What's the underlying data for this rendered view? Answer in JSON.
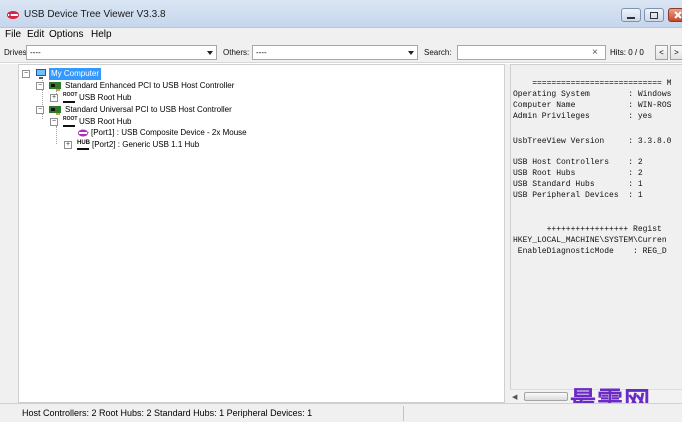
{
  "window": {
    "title": "USB Device Tree Viewer V3.3.8",
    "icon": "usb-icon",
    "controls": [
      "minimize-icon",
      "maximize-icon",
      "close-icon"
    ]
  },
  "menu": [
    "File",
    "Edit",
    "Options",
    "Help"
  ],
  "toolbar": {
    "drives_label": "Drives:",
    "drives_value": "----",
    "others_label": "Others:",
    "others_value": "----",
    "search_label": "Search:",
    "search_value": "",
    "clear_glyph": "×",
    "hits": "Hits: 0 / 0",
    "prev_label": "<",
    "next_label": ">"
  },
  "tree": [
    {
      "label": "My Computer",
      "icon": "computer-icon",
      "selected": true,
      "expander": "−"
    },
    {
      "label": "Standard Enhanced PCI to USB Host Controller",
      "icon": "pci-card-icon",
      "expander": "−"
    },
    {
      "label": "USB Root Hub",
      "icon": "root-hub-icon",
      "icon_text": "ROOT",
      "expander": "+"
    },
    {
      "label": "Standard Universal PCI to USB Host Controller",
      "icon": "pci-card-icon",
      "expander": "−"
    },
    {
      "label": "USB Root Hub",
      "icon": "root-hub-icon",
      "icon_text": "ROOT",
      "expander": "−"
    },
    {
      "label": "[Port1] : USB Composite Device - 2x Mouse",
      "icon": "usb-device-icon"
    },
    {
      "label": "[Port2] : Generic USB 1.1 Hub",
      "icon": "hub-icon",
      "icon_text": "HUB",
      "expander": "+"
    }
  ],
  "info_lines": [
    "    =========================== M",
    "Operating System        : Windows",
    "Computer Name           : WIN-ROS",
    "Admin Privileges        : yes",
    "",
    "UsbTreeView Version     : 3.3.8.0",
    "",
    "USB Host Controllers    : 2",
    "USB Root Hubs           : 2",
    "USB Standard Hubs       : 1",
    "USB Peripheral Devices  : 1",
    "",
    "",
    "       +++++++++++++++++ Regist",
    "HKEY_LOCAL_MACHINE\\SYSTEM\\Curren",
    " EnableDiagnosticMode    : REG_D"
  ],
  "status": {
    "text": "Host Controllers: 2   Root Hubs: 2   Standard Hubs: 1   Peripheral Devices: 1"
  },
  "watermark": "最需网",
  "colors": {
    "selection": "#3399ff",
    "titlebar": "#c5d6ec",
    "chrome": "#f0f0f0",
    "watermark": "#6a2bc4"
  }
}
